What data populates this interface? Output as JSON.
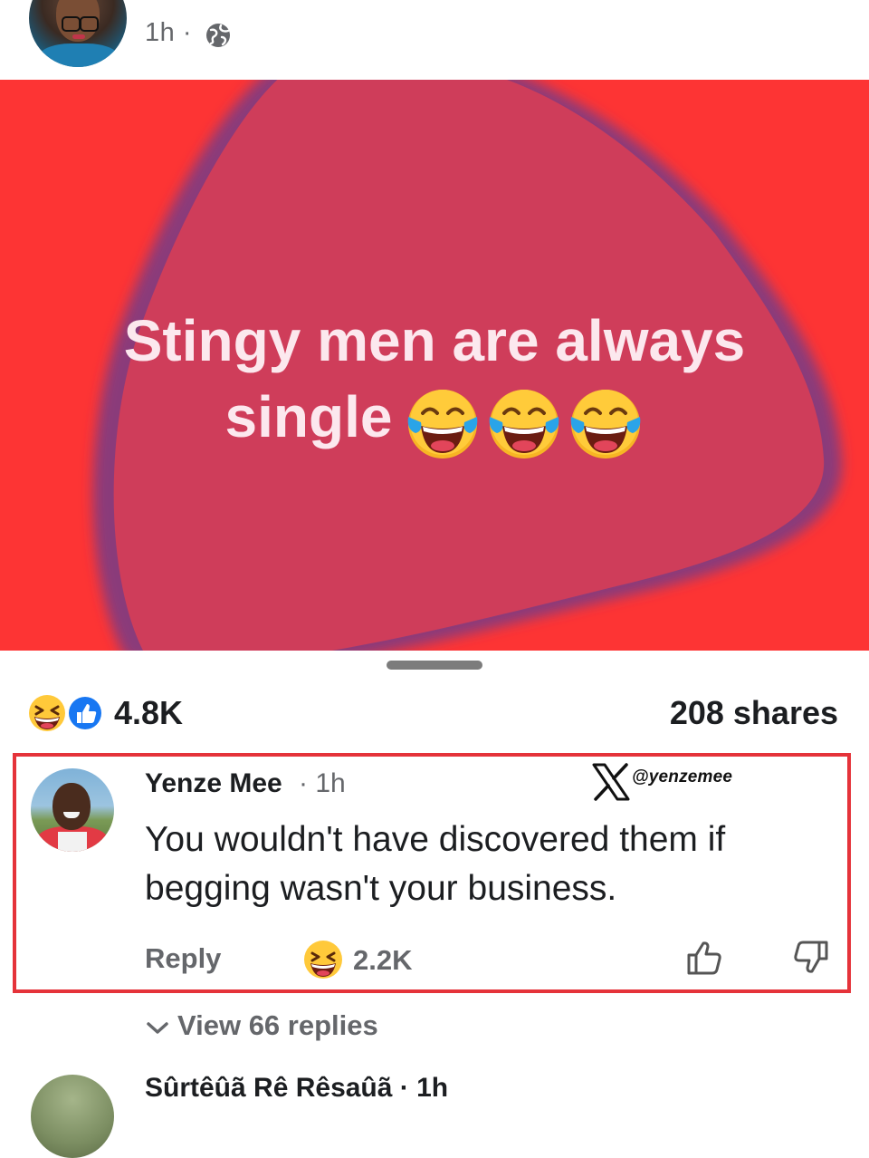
{
  "post": {
    "time": "1h ·",
    "privacy_icon": "globe-icon",
    "text_line1": "Stingy men are always",
    "text_line2": "single",
    "emoji": "face-with-tears-of-joy",
    "background_color": "#fd3434",
    "blob_color": "#cf3d5a"
  },
  "stats": {
    "reaction_icons": [
      "grinning-squinting-face-icon",
      "like-icon"
    ],
    "reactions": "4.8K",
    "shares": "208 shares"
  },
  "comment": {
    "author": "Yenze Mee",
    "time": "· 1h",
    "watermark_handle": "@yenzemee",
    "text": "You wouldn't have discovered them if begging wasn't your business.",
    "reply_label": "Reply",
    "reaction_count": "2.2K",
    "highlight_color": "#e5333a"
  },
  "view_replies": {
    "label": "View 66 replies"
  },
  "next_comment": {
    "author_partial": "Sûrtêûã Rê Rêsaûã · 1h"
  }
}
